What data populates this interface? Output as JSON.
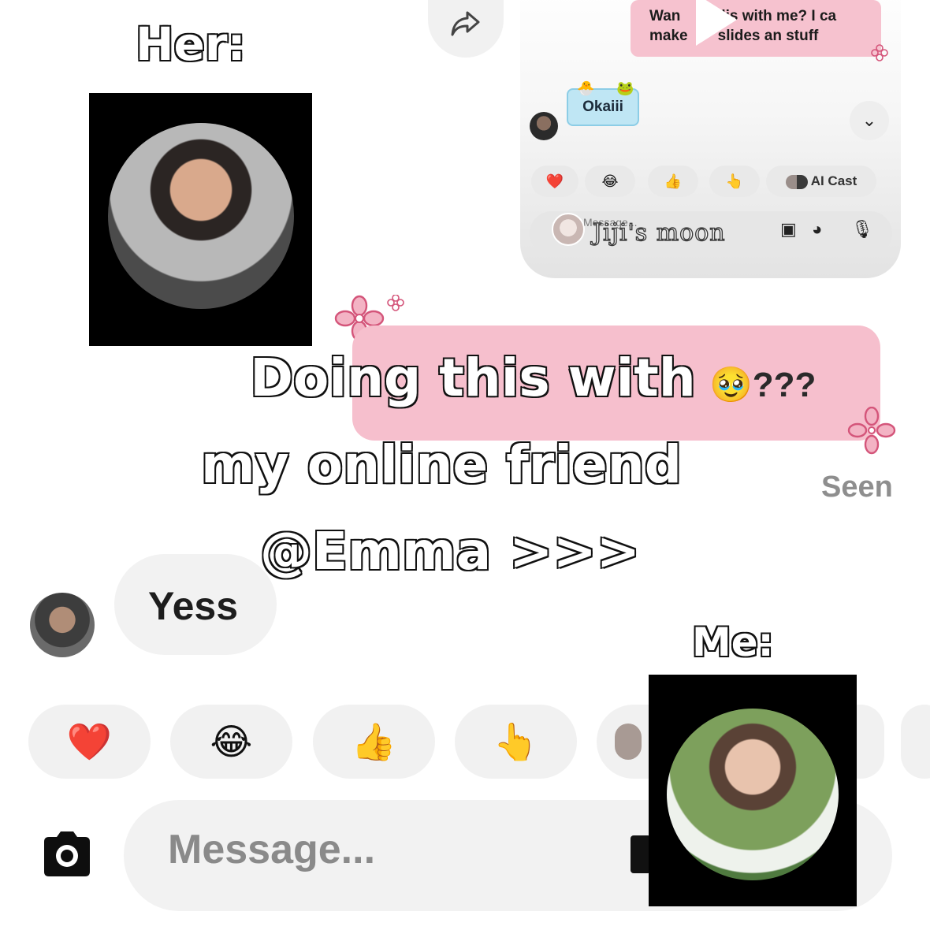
{
  "inset": {
    "bubble_text": "Wann  dis with me? I ca make  slides an stuff",
    "bubble_line1": "Wan            dis with me? I ca",
    "bubble_line2": "make          slides an stuff",
    "reply": "Okaiii",
    "reactions": [
      "❤️",
      "😂",
      "👍",
      "👆"
    ],
    "ai_cast": "AI Cast",
    "message_placeholder": "Message...",
    "sticker_name": "Jiji's moon",
    "chevron": "⌄"
  },
  "overlay": {
    "her_label": "Her:",
    "me_label": "Me:",
    "caption_line1": "Doing this with",
    "caption_line2": "my online friend",
    "caption_line3": "@Emma >>>"
  },
  "chat": {
    "outgoing_tail": "???",
    "outgoing_emoji": "🥹",
    "seen": "Seen",
    "incoming": "Yess",
    "reactions": [
      "❤️",
      "😂",
      "👍",
      "👆"
    ],
    "message_placeholder": "Message..."
  },
  "colors": {
    "pink_bubble": "#f6bfcd",
    "gray_bubble": "#f2f2f2",
    "seen_text": "#8e8e8e"
  },
  "icons": [
    "share-icon",
    "play-icon",
    "camera-icon",
    "flower-doodle",
    "mic-icon",
    "sticker-icon",
    "gallery-icon"
  ]
}
